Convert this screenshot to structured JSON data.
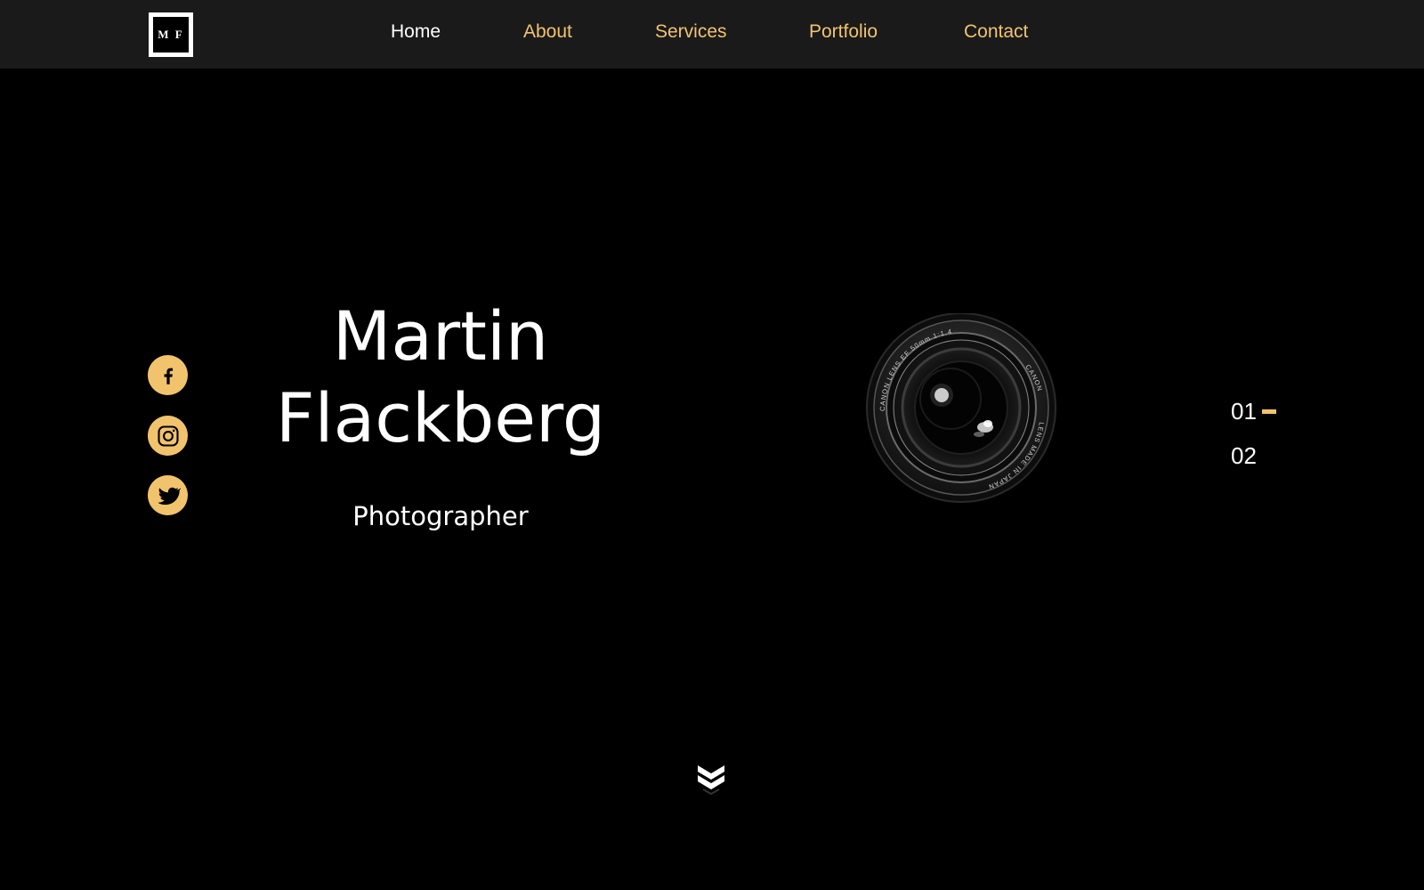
{
  "header": {
    "logo_text": "M F",
    "nav": [
      {
        "label": "Home",
        "active": true
      },
      {
        "label": "About",
        "active": false
      },
      {
        "label": "Services",
        "active": false
      },
      {
        "label": "Portfolio",
        "active": false
      },
      {
        "label": "Contact",
        "active": false
      }
    ]
  },
  "social": [
    {
      "icon": "facebook-icon"
    },
    {
      "icon": "instagram-icon"
    },
    {
      "icon": "twitter-icon"
    }
  ],
  "hero": {
    "first_name": "Martin",
    "last_name": "Flackberg",
    "role": "Photographer"
  },
  "lens": {
    "text_top": "CANON LENS EF 50mm 1:1.4",
    "text_right": "CANON",
    "text_bottom": "LENS MADE IN JAPAN"
  },
  "slides": {
    "items": [
      "01",
      "02"
    ],
    "active_index": 0
  },
  "colors": {
    "accent": "#f2c36d",
    "nav_background": "#1a1a1a",
    "page_background": "#000000",
    "text": "#ffffff"
  },
  "icons": {
    "scroll": "double-chevron-down-icon"
  }
}
